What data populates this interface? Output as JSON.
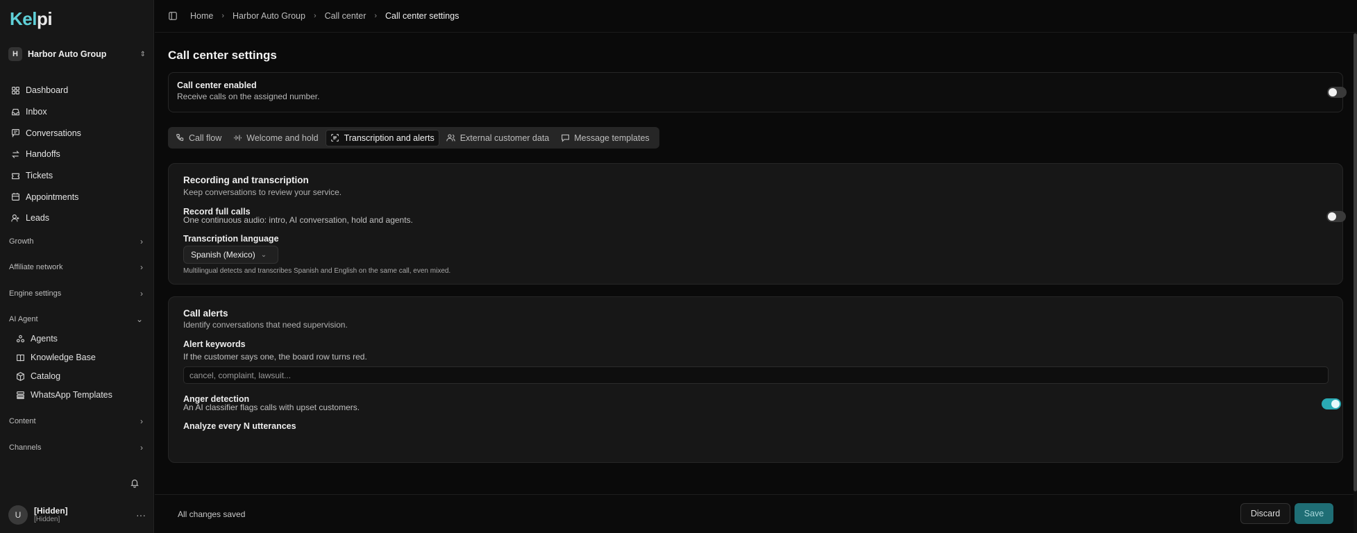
{
  "app": {
    "logo_a": "Kel",
    "logo_b": "pi"
  },
  "org": {
    "avatar": "H",
    "name": "Harbor Auto Group"
  },
  "sidebar": {
    "items": [
      {
        "label": "Dashboard",
        "icon": "dashboard-icon"
      },
      {
        "label": "Inbox",
        "icon": "inbox-icon"
      },
      {
        "label": "Conversations",
        "icon": "chat-icon"
      },
      {
        "label": "Handoffs",
        "icon": "swap-icon"
      },
      {
        "label": "Tickets",
        "icon": "ticket-icon"
      },
      {
        "label": "Appointments",
        "icon": "calendar-icon"
      },
      {
        "label": "Leads",
        "icon": "user-plus-icon"
      }
    ],
    "sections": {
      "growth": "Growth",
      "affiliate": "Affiliate network",
      "engine": "Engine settings",
      "ai_agent": "AI Agent",
      "content": "Content",
      "channels": "Channels"
    },
    "ai_agent_items": [
      {
        "label": "Agents",
        "icon": "agents-icon"
      },
      {
        "label": "Knowledge Base",
        "icon": "book-icon"
      },
      {
        "label": "Catalog",
        "icon": "box-icon"
      },
      {
        "label": "WhatsApp Templates",
        "icon": "template-icon"
      }
    ]
  },
  "user": {
    "avatar": "U",
    "name": "[Hidden]",
    "sub": "[Hidden]"
  },
  "breadcrumb": [
    "Home",
    "Harbor Auto Group",
    "Call center",
    "Call center settings"
  ],
  "page": {
    "title": "Call center settings"
  },
  "call_center": {
    "title": "Call center enabled",
    "desc": "Receive calls on the assigned number.",
    "enabled": false
  },
  "tabs": [
    {
      "label": "Call flow",
      "icon": "phone-icon",
      "active": false
    },
    {
      "label": "Welcome and hold",
      "icon": "audio-wave-icon",
      "active": false
    },
    {
      "label": "Transcription and alerts",
      "icon": "scan-text-icon",
      "active": true
    },
    {
      "label": "External customer data",
      "icon": "users-icon",
      "active": false
    },
    {
      "label": "Message templates",
      "icon": "message-icon",
      "active": false
    }
  ],
  "recording": {
    "title": "Recording and transcription",
    "desc": "Keep conversations to review your service.",
    "record_full_title": "Record full calls",
    "record_full_desc": "One continuous audio: intro, AI conversation, hold and agents.",
    "record_full_enabled": false,
    "lang_title": "Transcription language",
    "lang_value": "Spanish (Mexico)",
    "lang_note": "Multilingual detects and transcribes Spanish and English on the same call, even mixed."
  },
  "alerts": {
    "title": "Call alerts",
    "desc": "Identify conversations that need supervision.",
    "keywords_title": "Alert keywords",
    "keywords_desc": "If the customer says one, the board row turns red.",
    "keywords_placeholder": "cancel, complaint, lawsuit...",
    "anger_title": "Anger detection",
    "anger_desc": "An AI classifier flags calls with upset customers.",
    "anger_enabled": true,
    "analyze_title": "Analyze every N utterances"
  },
  "footer": {
    "status": "All changes saved",
    "discard": "Discard",
    "save": "Save"
  },
  "colors": {
    "accent": "#2aa9b3",
    "logo_accent": "#5fd0d8",
    "background": "#0a0a0a",
    "sidebar": "#171717"
  }
}
